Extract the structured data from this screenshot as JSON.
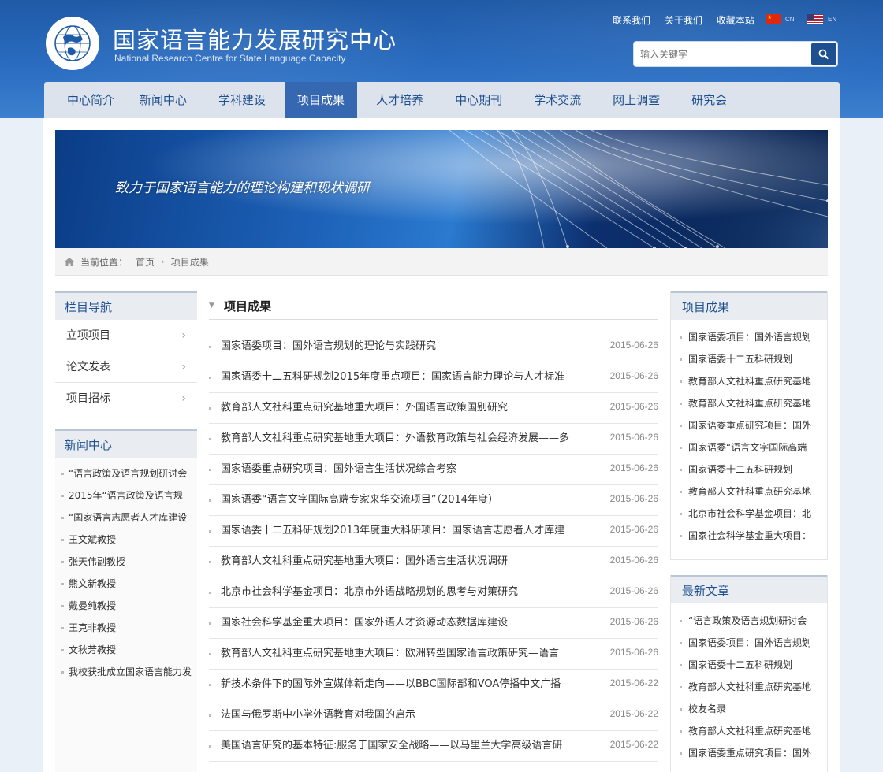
{
  "header": {
    "title_cn": "国家语言能力发展研究中心",
    "title_en": "National Research Centre for State Language Capacity",
    "logo_text": "国家语言能力发展研究中心 NRCSLC",
    "links": [
      "联系我们",
      "关于我们",
      "收藏本站"
    ],
    "lang_cn": "CN",
    "lang_en": "EN",
    "search_placeholder": "输入关键字"
  },
  "nav": {
    "items": [
      "中心简介",
      "新闻中心",
      "学科建设",
      "项目成果",
      "人才培养",
      "中心期刊",
      "学术交流",
      "网上调查",
      "研究会"
    ],
    "active_index": 3
  },
  "banner": {
    "slogan": "致力于国家语言能力的理论构建和现状调研"
  },
  "breadcrumb": {
    "label": "当前位置：",
    "home": "首页",
    "current": "项目成果"
  },
  "left": {
    "nav_title": "栏目导航",
    "nav_items": [
      "立项项目",
      "论文发表",
      "项目招标"
    ],
    "news_title": "新闻中心",
    "news_items": [
      "“语言政策及语言规划研讨会",
      "2015年“语言政策及语言规",
      "“国家语言志愿者人才库建设",
      "王文斌教授",
      "张天伟副教授",
      "熊文新教授",
      "戴曼纯教授",
      "王克非教授",
      "文秋芳教授",
      "我校获批成立国家语言能力发"
    ]
  },
  "center": {
    "title": "项目成果",
    "articles": [
      {
        "title": "国家语委项目：国外语言规划的理论与实践研究",
        "date": "2015-06-26"
      },
      {
        "title": "国家语委十二五科研规划2015年度重点项目：国家语言能力理论与人才标准",
        "date": "2015-06-26"
      },
      {
        "title": "教育部人文社科重点研究基地重大项目：外国语言政策国别研究",
        "date": "2015-06-26"
      },
      {
        "title": "教育部人文社科重点研究基地重大项目：外语教育政策与社会经济发展——多",
        "date": "2015-06-26"
      },
      {
        "title": "国家语委重点研究项目：国外语言生活状况综合考察",
        "date": "2015-06-26"
      },
      {
        "title": "国家语委“语言文字国际高端专家来华交流项目”（2014年度）",
        "date": "2015-06-26"
      },
      {
        "title": "国家语委十二五科研规划2013年度重大科研项目：国家语言志愿者人才库建",
        "date": "2015-06-26"
      },
      {
        "title": "教育部人文社科重点研究基地重大项目：国外语言生活状况调研",
        "date": "2015-06-26"
      },
      {
        "title": "北京市社会科学基金项目：北京市外语战略规划的思考与对策研究",
        "date": "2015-06-26"
      },
      {
        "title": "国家社会科学基金重大项目：国家外语人才资源动态数据库建设",
        "date": "2015-06-26"
      },
      {
        "title": "教育部人文社科重点研究基地重大项目：欧洲转型国家语言政策研究—语言",
        "date": "2015-06-26"
      },
      {
        "title": "新技术条件下的国际外宣媒体新走向——以BBC国际部和VOA停播中文广播",
        "date": "2015-06-22"
      },
      {
        "title": "法国与俄罗斯中小学外语教育对我国的启示",
        "date": "2015-06-22"
      },
      {
        "title": "美国语言研究的基本特征:服务于国家安全战略——以马里兰大学高级语言研",
        "date": "2015-06-22"
      }
    ]
  },
  "right": {
    "projects_title": "项目成果",
    "projects": [
      "国家语委项目：国外语言规划",
      "国家语委十二五科研规划",
      "教育部人文社科重点研究基地",
      "教育部人文社科重点研究基地",
      "国家语委重点研究项目：国外",
      "国家语委“语言文字国际高端",
      "国家语委十二五科研规划",
      "教育部人文社科重点研究基地",
      "北京市社会科学基金项目：北",
      "国家社会科学基金重大项目："
    ],
    "latest_title": "最新文章",
    "latest": [
      "“语言政策及语言规划研讨会",
      "国家语委项目：国外语言规划",
      "国家语委十二五科研规划",
      "教育部人文社科重点研究基地",
      "校友名录",
      "教育部人文社科重点研究基地",
      "国家语委重点研究项目：国外"
    ]
  }
}
